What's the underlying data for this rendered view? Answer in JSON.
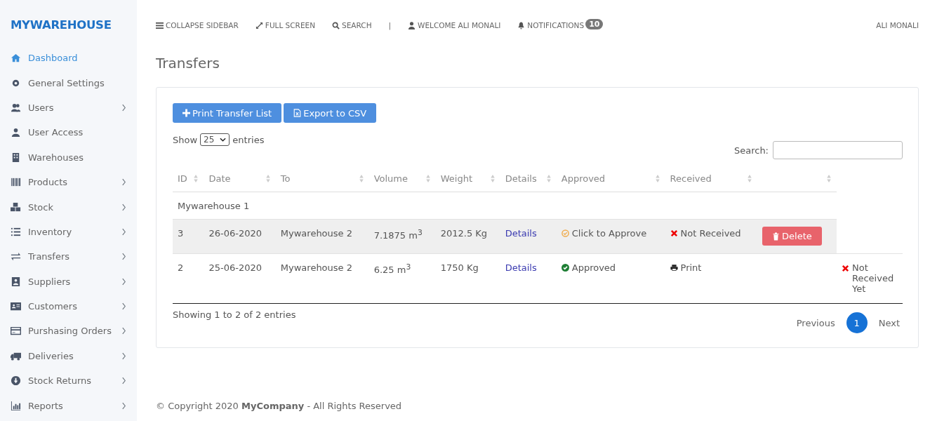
{
  "brand": "MYWAREHOUSE",
  "sidebar": {
    "items": [
      {
        "label": "Dashboard",
        "selected": true,
        "submenu": false
      },
      {
        "label": "General Settings",
        "selected": false,
        "submenu": false
      },
      {
        "label": "Users",
        "selected": false,
        "submenu": true
      },
      {
        "label": "User Access",
        "selected": false,
        "submenu": false
      },
      {
        "label": "Warehouses",
        "selected": false,
        "submenu": false
      },
      {
        "label": "Products",
        "selected": false,
        "submenu": true
      },
      {
        "label": "Stock",
        "selected": false,
        "submenu": true
      },
      {
        "label": "Inventory",
        "selected": false,
        "submenu": true
      },
      {
        "label": "Transfers",
        "selected": false,
        "submenu": true
      },
      {
        "label": "Suppliers",
        "selected": false,
        "submenu": true
      },
      {
        "label": "Customers",
        "selected": false,
        "submenu": true
      },
      {
        "label": "Purshasing Orders",
        "selected": false,
        "submenu": true
      },
      {
        "label": "Deliveries",
        "selected": false,
        "submenu": true
      },
      {
        "label": "Stock Returns",
        "selected": false,
        "submenu": true
      },
      {
        "label": "Reports",
        "selected": false,
        "submenu": true
      }
    ]
  },
  "topbar": {
    "collapse": "COLLAPSE SIDEBAR",
    "fullscreen": "FULL SCREEN",
    "search": "SEARCH",
    "separator": "|",
    "welcome": "WELCOME ALI MONALI",
    "notifications": "NOTIFICATIONS",
    "notification_count": "10",
    "user": "ALI MONALI"
  },
  "page_title": "Transfers",
  "buttons": {
    "print": "Print Transfer List",
    "export": "Export to CSV"
  },
  "length": {
    "show": "Show",
    "value": "25",
    "entries": "entries"
  },
  "search": {
    "label": "Search:"
  },
  "table": {
    "columns": [
      "ID",
      "Date",
      "To",
      "Volume",
      "Weight",
      "Details",
      "Approved",
      "Received",
      ""
    ],
    "group": "Mywarehouse 1",
    "rows": [
      {
        "id": "3",
        "date": "26-06-2020",
        "to": "Mywarehouse 2",
        "volume": "7.1875 m$^{3}$",
        "weight": "2012.5 Kg",
        "details": "Details",
        "highlighted": true,
        "approved": {
          "kind": "pending",
          "text": "Click to Approve"
        },
        "received": {
          "kind": "not-received",
          "text": "Not Received"
        },
        "action": {
          "kind": "delete",
          "text": "Delete"
        },
        "extra": null
      },
      {
        "id": "2",
        "date": "25-06-2020",
        "to": "Mywarehouse 2",
        "volume": "6.25 m$^{3}$",
        "weight": "1750 Kg",
        "details": "Details",
        "highlighted": false,
        "approved": {
          "kind": "approved",
          "text": "Approved"
        },
        "received": {
          "kind": "print",
          "text": "Print"
        },
        "action": null,
        "extra": {
          "kind": "not-received",
          "text": "Not Received Yet"
        }
      }
    ]
  },
  "info": "Showing 1 to 2 of 2 entries",
  "pagination": {
    "previous": "Previous",
    "pages": [
      {
        "label": "1",
        "selected": true
      }
    ],
    "next": "Next"
  },
  "footer": "© Copyright 2020 **MyCompany** - All Rights Reserved"
}
